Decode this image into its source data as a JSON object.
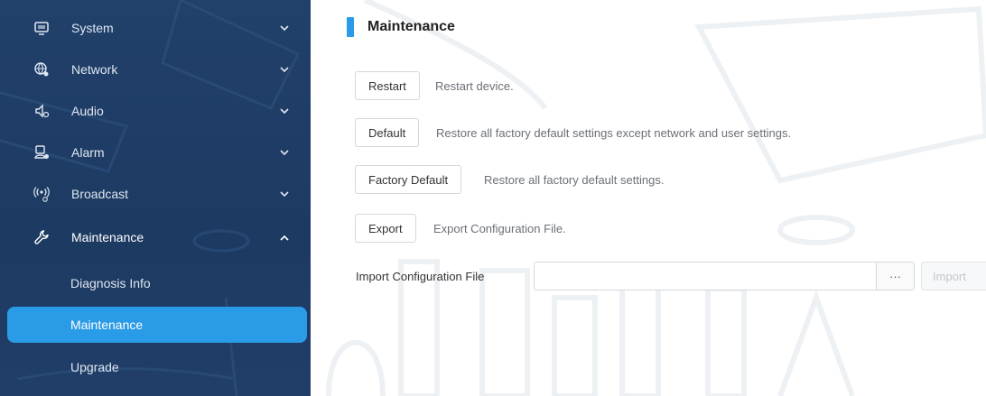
{
  "sidebar": {
    "items": [
      {
        "label": "System",
        "icon": "monitor-icon",
        "expanded": false
      },
      {
        "label": "Network",
        "icon": "globe-network-icon",
        "expanded": false
      },
      {
        "label": "Audio",
        "icon": "speaker-icon",
        "expanded": false
      },
      {
        "label": "Alarm",
        "icon": "alarm-user-icon",
        "expanded": false
      },
      {
        "label": "Broadcast",
        "icon": "broadcast-icon",
        "expanded": false
      },
      {
        "label": "Maintenance",
        "icon": "wrench-icon",
        "expanded": true
      }
    ],
    "subitems": [
      {
        "label": "Diagnosis Info",
        "active": false
      },
      {
        "label": "Maintenance",
        "active": true
      },
      {
        "label": "Upgrade",
        "active": false
      }
    ]
  },
  "main": {
    "title": "Maintenance",
    "actions": [
      {
        "button": "Restart",
        "description": "Restart device."
      },
      {
        "button": "Default",
        "description": "Restore all factory default settings except network and user settings."
      },
      {
        "button": "Factory Default",
        "description": "Restore all factory default settings."
      },
      {
        "button": "Export",
        "description": "Export Configuration File."
      }
    ],
    "import": {
      "label": "Import Configuration File",
      "value": "",
      "browse_label": "···",
      "import_label": "Import"
    }
  },
  "colors": {
    "sidebar_bg": "#1f3b63",
    "accent": "#2a9be6",
    "text_dark": "#222222",
    "text_muted": "#6b6f76"
  }
}
